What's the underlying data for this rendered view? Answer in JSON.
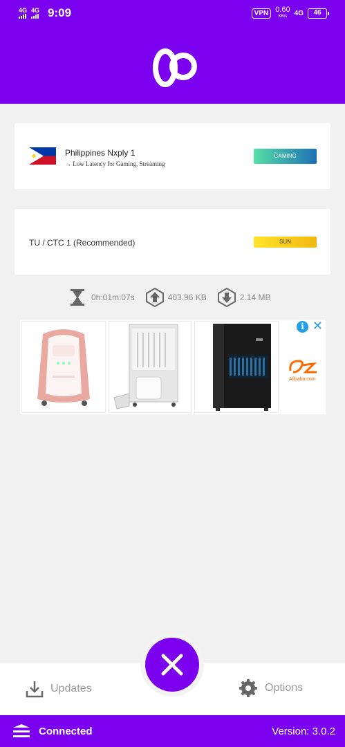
{
  "status_bar": {
    "sim1": "4G",
    "sim2": "4G",
    "time": "9:09",
    "vpn": "VPN",
    "speed_value": "0.60",
    "speed_unit": "KB/s",
    "network": "4G",
    "battery": "46"
  },
  "servers": {
    "primary": {
      "name": "Philippines Nxply 1",
      "description": "→ Low Latency for Gaming, Streaming",
      "tag": "GAMING",
      "flag_icon": "philippines-flag-icon"
    },
    "network": {
      "name": "TU / CTC 1 (Recommended)",
      "tag": "SUN"
    }
  },
  "stats": {
    "duration": "0h:01m:07s",
    "upload": "403.96 KB",
    "download": "2.14 MB"
  },
  "ad": {
    "info": "i",
    "close": "✕",
    "brand_text": "Alibaba.com"
  },
  "nav": {
    "updates_label": "Updates",
    "options_label": "Options",
    "disconnect_icon": "close-icon"
  },
  "footer": {
    "status": "Connected",
    "version": "Version:  3.0.2"
  },
  "colors": {
    "primary": "#7a00ee",
    "background": "#f1f1f1",
    "ad_accent": "#23a0e6"
  }
}
